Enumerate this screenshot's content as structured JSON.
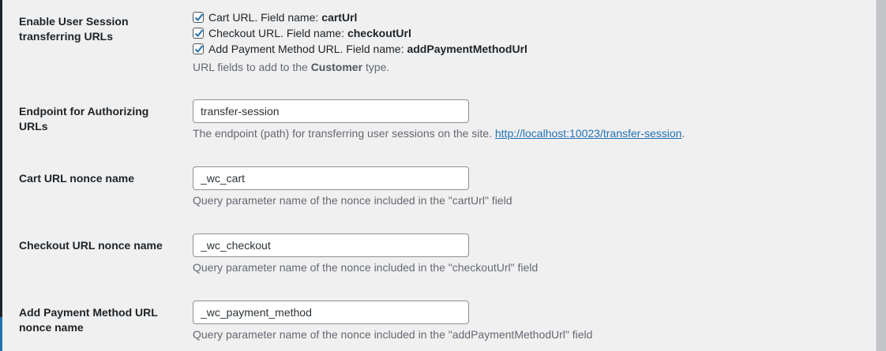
{
  "session_urls": {
    "label": "Enable User Session transferring URLs",
    "options": [
      {
        "text": "Cart URL. Field name:",
        "field": "cartUrl",
        "checked": true
      },
      {
        "text": "Checkout URL. Field name:",
        "field": "checkoutUrl",
        "checked": true
      },
      {
        "text": "Add Payment Method URL. Field name:",
        "field": "addPaymentMethodUrl",
        "checked": true
      }
    ],
    "description_prefix": "URL fields to add to the",
    "description_type": "Customer",
    "description_suffix": "type."
  },
  "endpoint": {
    "label": "Endpoint for Authorizing URLs",
    "value": "transfer-session",
    "description": "The endpoint (path) for transferring user sessions on the site.",
    "link": "http://localhost:10023/transfer-session",
    "link_suffix": "."
  },
  "cart_nonce": {
    "label": "Cart URL nonce name",
    "value": "_wc_cart",
    "description": "Query parameter name of the nonce included in the \"cartUrl\" field"
  },
  "checkout_nonce": {
    "label": "Checkout URL nonce name",
    "value": "_wc_checkout",
    "description": "Query parameter name of the nonce included in the \"checkoutUrl\" field"
  },
  "payment_nonce": {
    "label": "Add Payment Method URL nonce name",
    "value": "_wc_payment_method",
    "description": "Query parameter name of the nonce included in the \"addPaymentMethodUrl\" field"
  },
  "colors": {
    "background": "#f0f0f1",
    "accent": "#2271b1",
    "text": "#1d2327",
    "muted": "#646970"
  },
  "icons": {
    "checkbox_check": "checkmark-icon"
  }
}
